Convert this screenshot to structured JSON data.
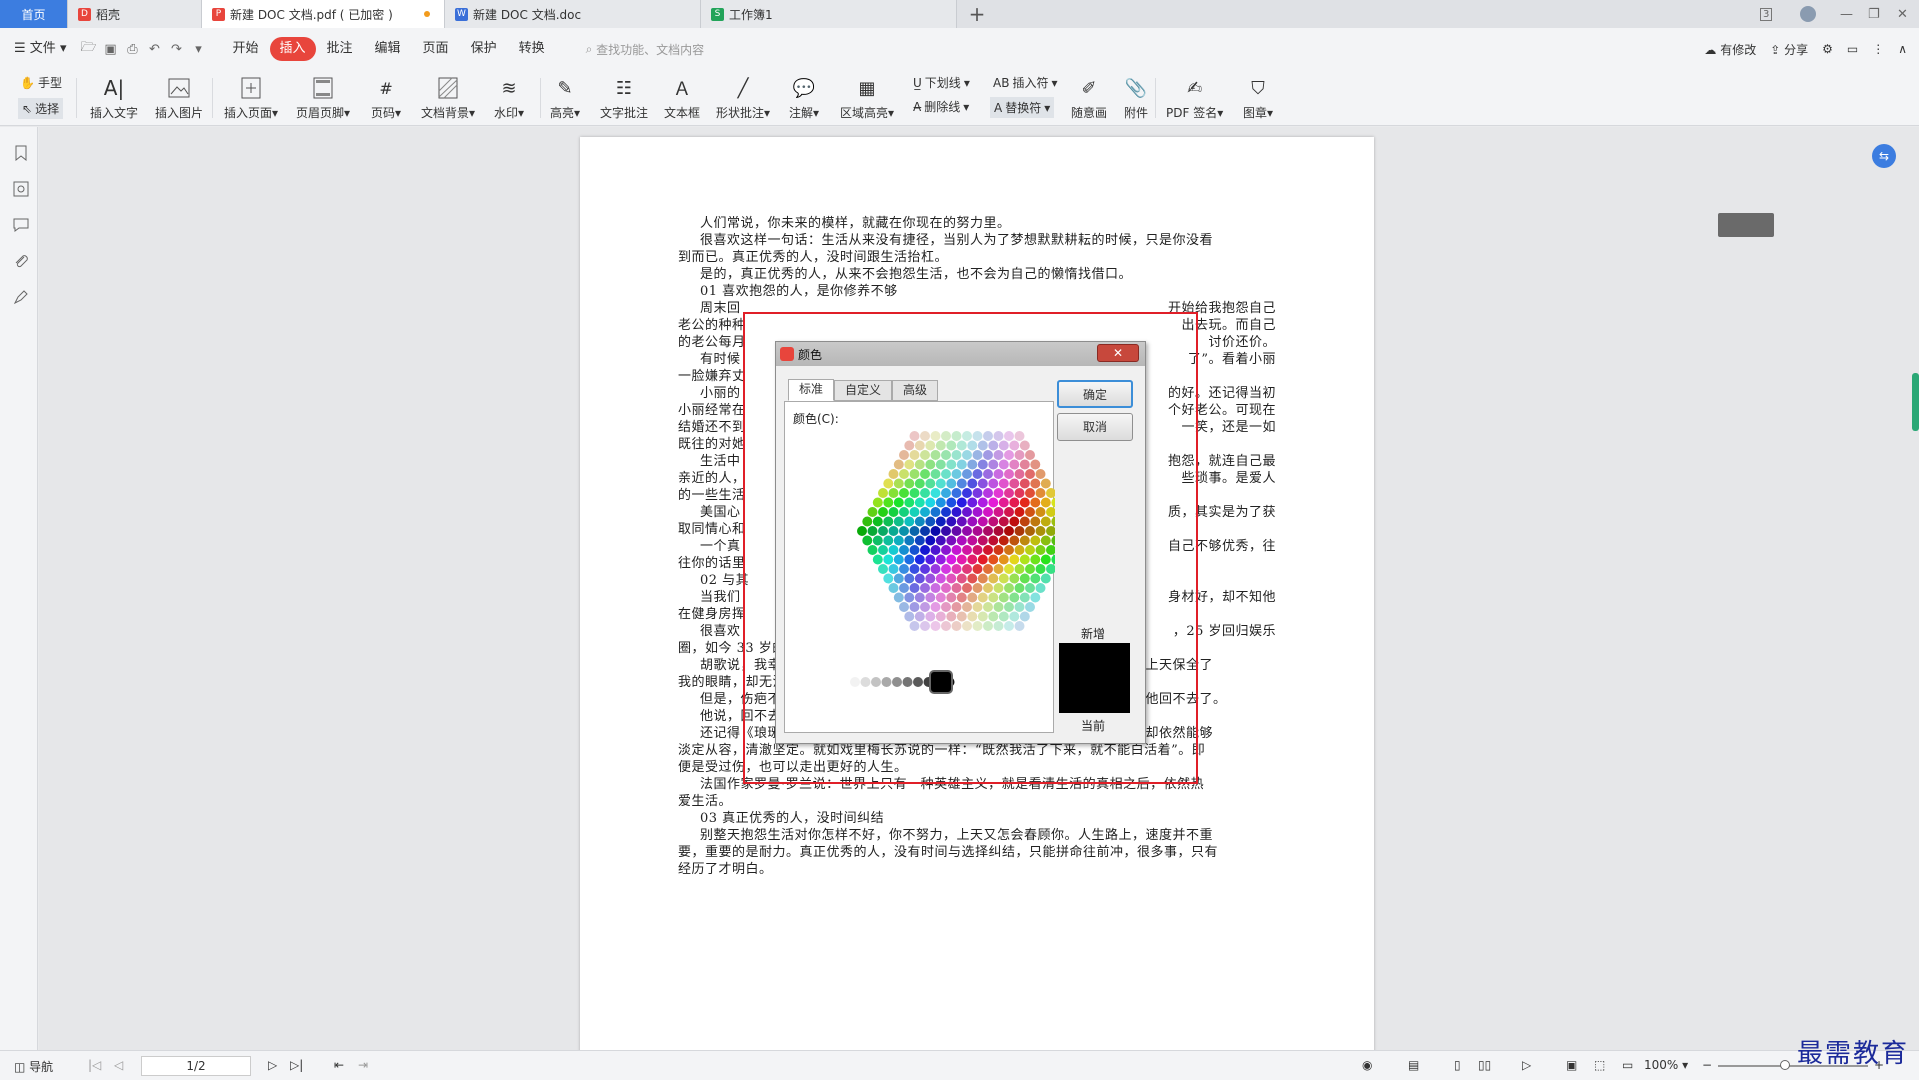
{
  "tabs": [
    {
      "label": "首页"
    },
    {
      "label": "稻壳"
    },
    {
      "label": "新建 DOC 文档.pdf ( 已加密 )"
    },
    {
      "label": "新建 DOC 文档.doc"
    },
    {
      "label": "工作簿1"
    }
  ],
  "window_controls": {
    "badge": "3"
  },
  "menu": {
    "file": "文件",
    "items": [
      "开始",
      "插入",
      "批注",
      "编辑",
      "页面",
      "保护",
      "转换"
    ],
    "active": "插入",
    "search_placeholder": "查找功能、文档内容",
    "modify": "有修改",
    "share": "分享"
  },
  "ribbon": {
    "hand": "手型",
    "select": "选择",
    "insert_text": "插入文字",
    "insert_image": "插入图片",
    "insert_page": "插入页面",
    "header_footer": "页眉页脚",
    "page_number": "页码",
    "doc_background": "文档背景",
    "watermark": "水印",
    "highlight": "高亮",
    "text_comment": "文字批注",
    "textbox": "文本框",
    "shape_comment": "形状批注",
    "annotation": "注解",
    "area_highlight": "区域高亮",
    "underline": "下划线",
    "strikethrough": "删除线",
    "insert_symbol": "插入符",
    "replace_symbol": "替换符",
    "freehand": "随意画",
    "attachment": "附件",
    "pdf_sign": "PDF 签名",
    "stamp": "图章"
  },
  "document": {
    "lines": [
      "人们常说，你未来的模样，就藏在你现在的努力里。",
      "很喜欢这样一句话：生活从来没有捷径，当别人为了梦想默默耕耘的时候，只是你没看",
      "到而已。真正优秀的人，没时间跟生活抬杠。",
      "是的，真正优秀的人，从来不会抱怨生活，也不会为自己的懒惰找借口。",
      "01 喜欢抱怨的人，是你修养不够",
      "周末回",
      "老公的种种",
      "的老公每月",
      "有时候",
      "一脸嫌弃丈",
      "小丽的",
      "小丽经常在",
      "结婚还不到",
      "既往的对她",
      "生活中",
      "亲近的人，",
      "的一些生活",
      "美国心",
      "取同情心和",
      "一个真",
      "往你的话里",
      "02 与其",
      "当我们",
      "在健身房挥",
      "很喜欢",
      "圈，如今 33 岁的他，看上去更加成熟、稳重。",
      "胡歌说，我幸运的是最先找回了生命，却看着另一个生命逐渐远去，我感谢上天保全了",
      "我的眼睛，却无法在感受光明的同时去认领残破的容颜。",
      "但是，伤疤不是他的缺陷，而是一枚勋章。很多人说，李逍遥是他的巅峰，他回不去了。",
      "他说，回不去的皮囊，可以用思想填满。",
      "还记得《琅琊榜》中的梅长苏，其实正是胡歌的另一个自己，经历过黑暗，却依然能够",
      "淡定从容，清澈坚定。就如戏里梅长苏说的一样：“既然我活了下来，就不能白活着”。即",
      "便是受过伤，也可以走出更好的人生。",
      "法国作家罗曼·罗兰说：世界上只有一种英雄主义，就是看清生活的真相之后，依然热",
      "爱生活。",
      "03 真正优秀的人，没时间纠结",
      "别整天抱怨生活对你怎样不好，你不努力，上天又怎会春顾你。人生路上，速度并不重",
      "要，重要的是耐力。真正优秀的人，没有时间与选择纠结，只能拼命往前冲，很多事，只有",
      "经历了才明白。"
    ],
    "right_fragments": [
      "开始给我抱怨自己",
      "出去玩。而自己",
      "讨价还价。",
      "了”。看着小丽",
      "的好。还记得当初",
      "个好老公。可现在",
      "一笑，还是一如",
      "抱怨，就连自己最",
      "些琐事。是爱人",
      "质，其实是为了获",
      "自己不够优秀，往",
      "身材好，却不知他",
      "，25 岁回归娱乐"
    ]
  },
  "dialog": {
    "title": "颜色",
    "tabs": [
      "标准",
      "自定义",
      "高级"
    ],
    "active_tab": "标准",
    "colors_label": "颜色(C):",
    "ok": "确定",
    "cancel": "取消",
    "new_label": "新增",
    "current_label": "当前",
    "close": "✕",
    "selected_color": "#000000"
  },
  "statusbar": {
    "nav": "导航",
    "page": "1/2",
    "zoom": "100%"
  },
  "watermark": "最需教育",
  "colors": {
    "accent": "#3c7de0",
    "active_tab": "#e8453c",
    "highlight_box": "#e01f28"
  }
}
